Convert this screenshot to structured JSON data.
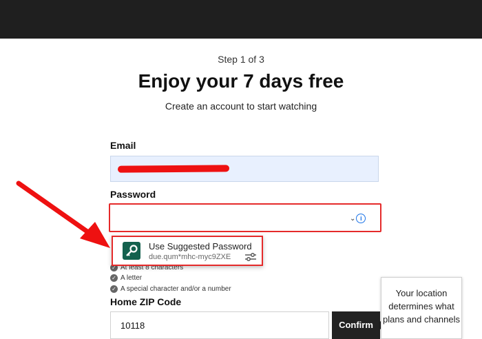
{
  "header": {
    "step": "Step 1 of 3",
    "title": "Enjoy your 7 days free",
    "subtitle": "Create an account to start watching"
  },
  "email": {
    "label": "Email",
    "value_redacted": true
  },
  "password": {
    "label": "Password"
  },
  "suggestion": {
    "title": "Use Suggested Password",
    "password": "due.qum*mhc-myc9ZXE",
    "icon": "key-icon",
    "options_icon": "tune-icon"
  },
  "requirements": [
    {
      "text": "At least 8 characters",
      "hidden": true
    },
    {
      "text": "A letter"
    },
    {
      "text": "A special character and/or a number"
    }
  ],
  "zip": {
    "label": "Home ZIP Code",
    "value": "10118"
  },
  "confirm_label": "Confirm",
  "tooltip": "Your location determines what plans and channels",
  "annotation": {
    "color": "#ee1111"
  }
}
